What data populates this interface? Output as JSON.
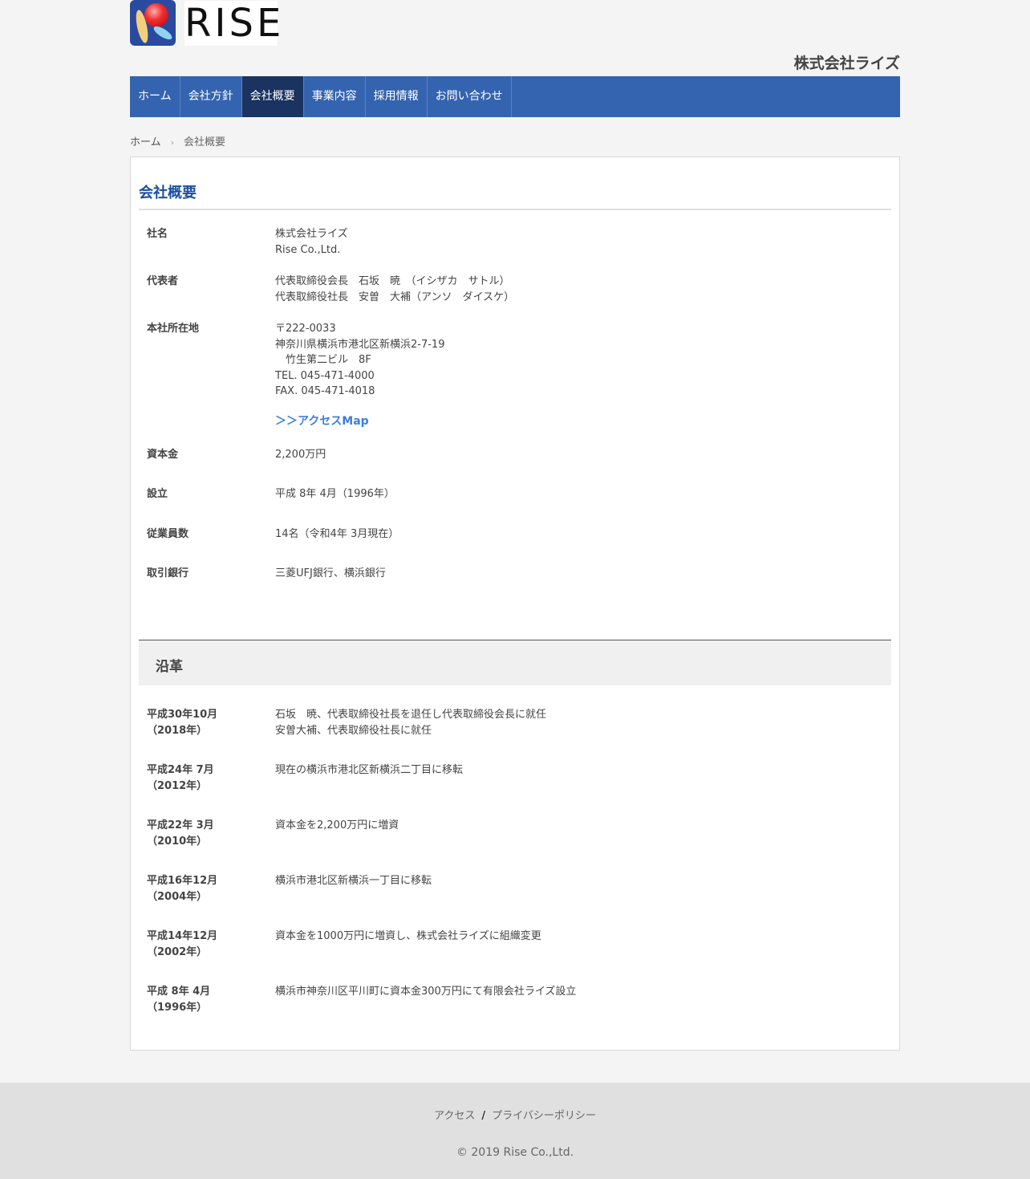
{
  "header": {
    "logo_text": "RISE",
    "company_name": "株式会社ライズ"
  },
  "nav": {
    "items": [
      {
        "label": "ホーム"
      },
      {
        "label": "会社方針"
      },
      {
        "label": "会社概要"
      },
      {
        "label": "事業内容"
      },
      {
        "label": "採用情報"
      },
      {
        "label": "お問い合わせ"
      }
    ],
    "active_index": 2
  },
  "breadcrumb": {
    "home": "ホーム",
    "separator": "›",
    "current": "会社概要"
  },
  "overview": {
    "title": "会社概要",
    "rows": [
      {
        "label": "社名",
        "lines": [
          "株式会社ライズ",
          "Rise Co.,Ltd."
        ]
      },
      {
        "label": "代表者",
        "lines": [
          "代表取締役会長　石坂　暁　（イシザカ　サトル）",
          "代表取締役社長　安曽　大補（アンソ　ダイスケ）"
        ]
      },
      {
        "label": "本社所在地",
        "lines": [
          "〒222-0033",
          "神奈川県横浜市港北区新横浜2-7-19",
          "　竹生第二ビル　8F",
          "TEL. 045-471-4000",
          "FAX. 045-471-4018"
        ],
        "link": "＞＞アクセスMap"
      },
      {
        "label": "資本金",
        "lines": [
          "2,200万円"
        ]
      },
      {
        "label": "設立",
        "lines": [
          "平成 8年 4月（1996年）"
        ]
      },
      {
        "label": "従業員数",
        "lines": [
          "14名（令和4年 3月現在）"
        ]
      },
      {
        "label": "取引銀行",
        "lines": [
          "三菱UFJ銀行、横浜銀行"
        ]
      }
    ]
  },
  "history": {
    "title": "沿革",
    "rows": [
      {
        "date": [
          "平成30年10月",
          "（2018年）"
        ],
        "lines": [
          "石坂　暁、代表取締役社長を退任し代表取締役会長に就任",
          "安曽大補、代表取締役社長に就任"
        ]
      },
      {
        "date": [
          "平成24年 7月",
          "（2012年）"
        ],
        "lines": [
          "現在の横浜市港北区新横浜二丁目に移転"
        ]
      },
      {
        "date": [
          "平成22年 3月",
          "（2010年）"
        ],
        "lines": [
          "資本金を2,200万円に増資"
        ]
      },
      {
        "date": [
          "平成16年12月",
          "（2004年）"
        ],
        "lines": [
          "横浜市港北区新横浜一丁目に移転"
        ]
      },
      {
        "date": [
          "平成14年12月",
          "（2002年）"
        ],
        "lines": [
          "資本金を1000万円に増資し、株式会社ライズに組織変更"
        ]
      },
      {
        "date": [
          "平成 8年 4月",
          "（1996年）"
        ],
        "lines": [
          "横浜市神奈川区平川町に資本金300万円にて有限会社ライズ設立"
        ]
      }
    ]
  },
  "footer": {
    "links": [
      "アクセス",
      "プライバシーポリシー"
    ],
    "link_separator": "/",
    "copyright": "© 2019 Rise Co.,Ltd."
  }
}
